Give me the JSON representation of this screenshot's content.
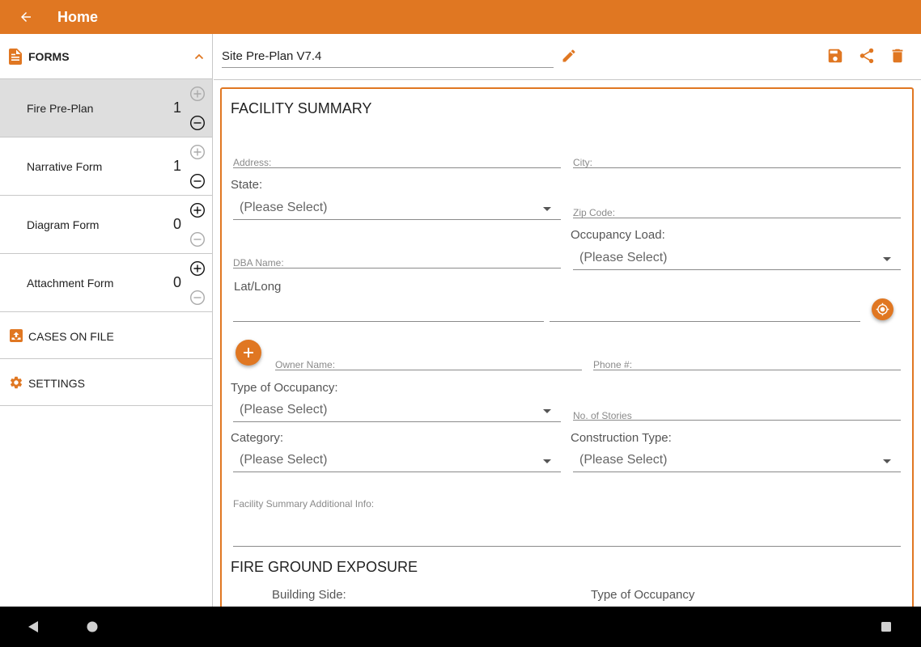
{
  "app_bar": {
    "title": "Home",
    "back_icon": "arrow-left-icon",
    "color": "#e07722"
  },
  "sidebar": {
    "forms_header": {
      "label": "FORMS",
      "icon": "document-icon",
      "expanded_icon": "chevron-up-icon"
    },
    "forms": [
      {
        "name": "Fire Pre-Plan",
        "count": "1",
        "selected": true
      },
      {
        "name": "Narrative Form",
        "count": "1",
        "selected": false
      },
      {
        "name": "Diagram Form",
        "count": "0",
        "selected": false
      },
      {
        "name": "Attachment Form",
        "count": "0",
        "selected": false
      }
    ],
    "cases_on_file": {
      "label": "CASES ON FILE",
      "icon": "inbox-upload-icon"
    },
    "settings": {
      "label": "SETTINGS",
      "icon": "gear-icon"
    }
  },
  "toolbar": {
    "form_title": "Site Pre-Plan V7.4",
    "edit_icon": "pencil-icon",
    "save_icon": "save-icon",
    "share_icon": "share-icon",
    "delete_icon": "trash-icon"
  },
  "form": {
    "facility_summary": {
      "title": "FACILITY SUMMARY",
      "address_label": "Address:",
      "city_label": "City:",
      "state_label": "State:",
      "state_value": "(Please Select)",
      "zip_label": "Zip Code:",
      "occupancy_load_label": "Occupancy Load:",
      "occupancy_load_value": "(Please Select)",
      "dba_label": "DBA Name:",
      "latlong_label": "Lat/Long",
      "owner_label": "Owner Name:",
      "phone_label": "Phone #:",
      "type_occupancy_label": "Type of Occupancy:",
      "type_occupancy_value": "(Please Select)",
      "stories_label": "No. of Stories",
      "category_label": "Category:",
      "category_value": "(Please Select)",
      "construction_label": "Construction Type:",
      "construction_value": "(Please Select)",
      "additional_info_label": "Facility Summary Additional Info:"
    },
    "fire_ground_exposure": {
      "title": "FIRE GROUND EXPOSURE",
      "building_side_label": "Building Side:",
      "type_occupancy_label": "Type of Occupancy"
    }
  },
  "colors": {
    "accent": "#e07722",
    "selected_row": "#dedede"
  }
}
